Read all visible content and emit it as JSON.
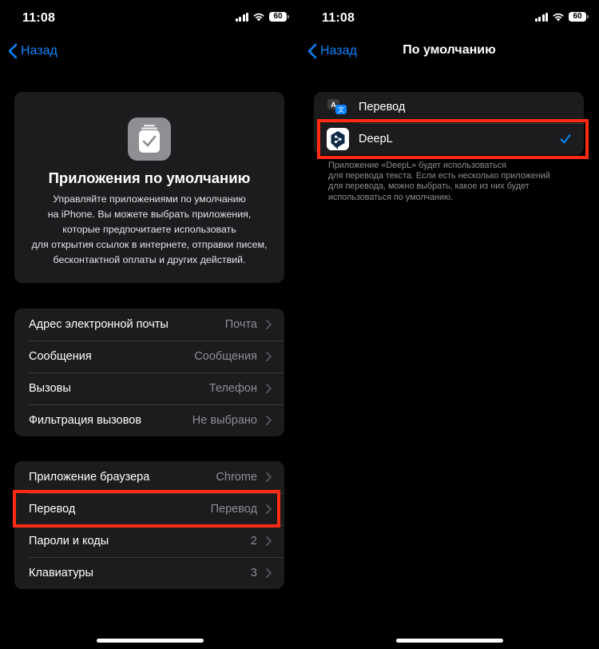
{
  "status": {
    "time": "11:08",
    "battery": "60"
  },
  "left": {
    "nav": {
      "back_label": "Назад"
    },
    "hero": {
      "title": "Приложения по умолчанию",
      "description_lines": [
        "Управляйте приложениями по умолчанию",
        "на iPhone. Вы можете выбрать приложения,",
        "которые предпочитаете использовать",
        "для открытия ссылок в интернете, отправки писем,",
        "бесконтактной оплаты и других действий."
      ]
    },
    "group1": [
      {
        "label": "Адрес электронной почты",
        "value": "Почта"
      },
      {
        "label": "Сообщения",
        "value": "Сообщения"
      },
      {
        "label": "Вызовы",
        "value": "Телефон"
      },
      {
        "label": "Фильтрация вызовов",
        "value": "Не выбрано"
      }
    ],
    "group2": [
      {
        "label": "Приложение браузера",
        "value": "Chrome"
      },
      {
        "label": "Перевод",
        "value": "Перевод"
      },
      {
        "label": "Пароли и коды",
        "value": "2"
      },
      {
        "label": "Клавиатуры",
        "value": "3"
      }
    ]
  },
  "right": {
    "nav": {
      "back_label": "Назад",
      "title": "По умолчанию"
    },
    "options": [
      {
        "label": "Перевод",
        "selected": false
      },
      {
        "label": "DeepL",
        "selected": true
      }
    ],
    "footnote_lines": [
      "Приложение «DeepL» будет использоваться",
      "для перевода текста. Если есть несколько приложений",
      "для перевода, можно выбрать, какое из них будет",
      "использоваться по умолчанию."
    ]
  },
  "colors": {
    "accent": "#0a84ff",
    "highlight": "#ff2a14",
    "group_bg": "#1c1c1e",
    "deepl_bg": "#0f2b46"
  },
  "icons": [
    "signal-icon",
    "wifi-icon",
    "battery-icon",
    "chevron-left-icon",
    "chevron-right-icon",
    "default-apps-icon",
    "translate-app-icon",
    "deepl-app-icon",
    "checkmark-icon"
  ]
}
